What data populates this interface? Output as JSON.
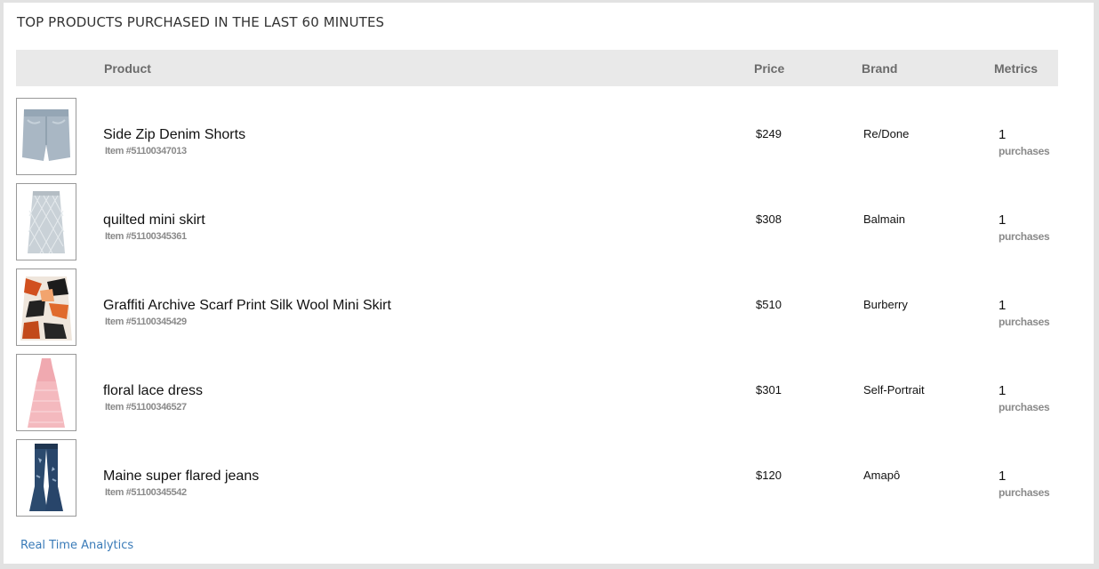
{
  "title": "TOP PRODUCTS PURCHASED IN THE LAST 60 MINUTES",
  "columns": {
    "product": "Product",
    "price": "Price",
    "brand": "Brand",
    "metrics": "Metrics"
  },
  "rows": [
    {
      "name": "Side Zip Denim Shorts",
      "item": "Item #51100347013",
      "price": "$249",
      "brand": "Re/Done",
      "metric": "1",
      "metric_label": "purchases",
      "thumbnail": "denim-shorts-image"
    },
    {
      "name": "quilted mini skirt",
      "item": "Item #51100345361",
      "price": "$308",
      "brand": "Balmain",
      "metric": "1",
      "metric_label": "purchases",
      "thumbnail": "quilted-skirt-image"
    },
    {
      "name": "Graffiti Archive Scarf Print Silk Wool Mini Skirt",
      "item": "Item #51100345429",
      "price": "$510",
      "brand": "Burberry",
      "metric": "1",
      "metric_label": "purchases",
      "thumbnail": "print-skirt-image"
    },
    {
      "name": "floral lace dress",
      "item": "Item #51100346527",
      "price": "$301",
      "brand": "Self-Portrait",
      "metric": "1",
      "metric_label": "purchases",
      "thumbnail": "lace-dress-image"
    },
    {
      "name": "Maine super flared jeans",
      "item": "Item #51100345542",
      "price": "$120",
      "brand": "Amapô",
      "metric": "1",
      "metric_label": "purchases",
      "thumbnail": "flared-jeans-image"
    }
  ],
  "footer": {
    "link": "Real Time Analytics"
  },
  "colors": {
    "header_bg": "#e9e9e9",
    "link": "#3a7bb8",
    "header_text": "#6b6b6b"
  }
}
